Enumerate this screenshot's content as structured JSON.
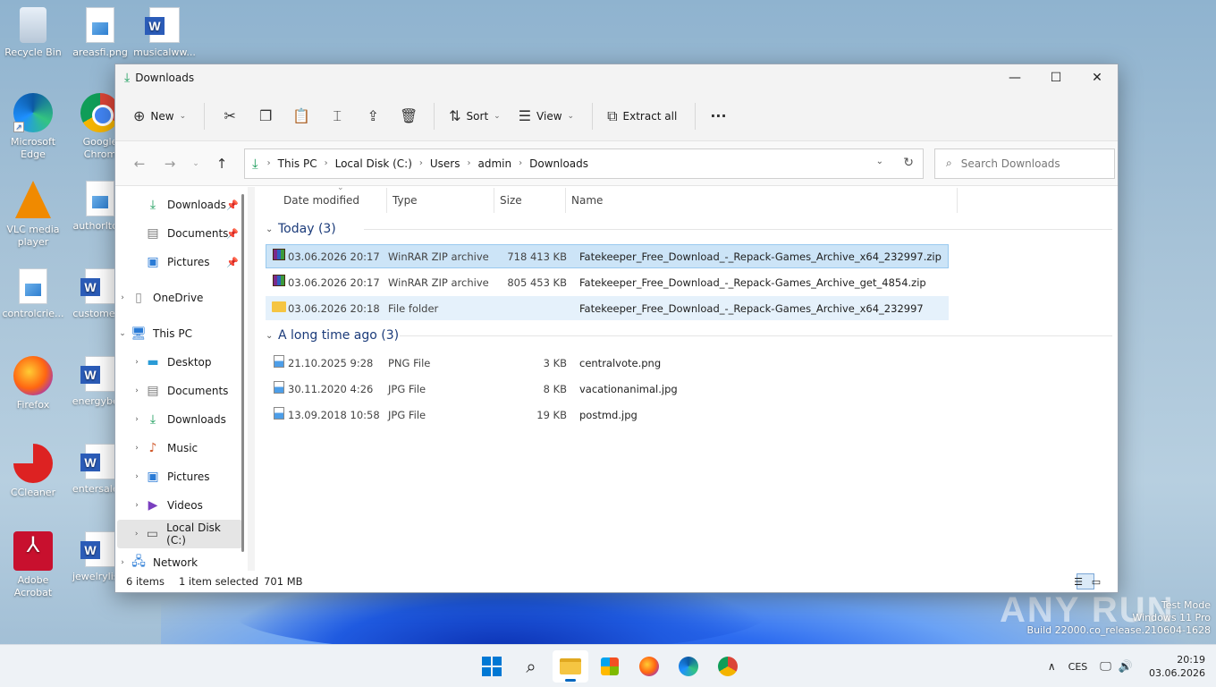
{
  "desktop": {
    "icons": [
      {
        "label": "Recycle Bin"
      },
      {
        "label": "areasfi.png"
      },
      {
        "label": "musicalww..."
      },
      {
        "label": "Microsoft\nEdge"
      },
      {
        "label": "Google\nChrom"
      },
      {
        "label": "VLC media\nplayer"
      },
      {
        "label": "authorltd..."
      },
      {
        "label": "controlcrie..."
      },
      {
        "label": "customer..."
      },
      {
        "label": "Firefox"
      },
      {
        "label": "energybe..."
      },
      {
        "label": "CCleaner"
      },
      {
        "label": "entersale..."
      },
      {
        "label": "Adobe\nAcrobat"
      },
      {
        "label": "jewelrylis..."
      }
    ]
  },
  "window": {
    "title": "Downloads",
    "controls": {
      "minimize": "—",
      "maximize": "☐",
      "close": "✕"
    }
  },
  "toolbar": {
    "new_label": "New",
    "sort_label": "Sort",
    "view_label": "View",
    "extract_label": "Extract all",
    "more_label": "···"
  },
  "address": {
    "crumbs": [
      "This PC",
      "Local Disk (C:)",
      "Users",
      "admin",
      "Downloads"
    ]
  },
  "search": {
    "placeholder": "Search Downloads"
  },
  "nav_pane": {
    "quick": [
      {
        "label": "Downloads",
        "icon": "download-icon"
      },
      {
        "label": "Documents",
        "icon": "document-icon"
      },
      {
        "label": "Pictures",
        "icon": "pictures-icon"
      }
    ],
    "onedrive": "OneDrive",
    "thispc": "This PC",
    "thispc_children": [
      {
        "label": "Desktop"
      },
      {
        "label": "Documents"
      },
      {
        "label": "Downloads"
      },
      {
        "label": "Music"
      },
      {
        "label": "Pictures"
      },
      {
        "label": "Videos"
      },
      {
        "label": "Local Disk (C:)"
      }
    ],
    "network": "Network"
  },
  "columns": {
    "date": "Date modified",
    "type": "Type",
    "size": "Size",
    "name": "Name"
  },
  "groups": [
    {
      "title": "Today (3)",
      "rows": [
        {
          "date": "03.06.2026 20:17",
          "type": "WinRAR ZIP archive",
          "size": "718 413 KB",
          "name": "Fatekeeper_Free_Download_-_Repack-Games_Archive_x64_232997.zip",
          "icon": "rar",
          "state": "selected"
        },
        {
          "date": "03.06.2026 20:17",
          "type": "WinRAR ZIP archive",
          "size": "805 453 KB",
          "name": "Fatekeeper_Free_Download_-_Repack-Games_Archive_get_4854.zip",
          "icon": "rar",
          "state": ""
        },
        {
          "date": "03.06.2026 20:18",
          "type": "File folder",
          "size": "",
          "name": "Fatekeeper_Free_Download_-_Repack-Games_Archive_x64_232997",
          "icon": "folder",
          "state": "hover"
        }
      ]
    },
    {
      "title": "A long time ago (3)",
      "rows": [
        {
          "date": "21.10.2025 9:28",
          "type": "PNG File",
          "size": "3 KB",
          "name": "centralvote.png",
          "icon": "image",
          "state": ""
        },
        {
          "date": "30.11.2020 4:26",
          "type": "JPG File",
          "size": "8 KB",
          "name": "vacationanimal.jpg",
          "icon": "image",
          "state": ""
        },
        {
          "date": "13.09.2018 10:58",
          "type": "JPG File",
          "size": "19 KB",
          "name": "postmd.jpg",
          "icon": "image",
          "state": ""
        }
      ]
    }
  ],
  "status": {
    "items": "6 items",
    "selected": "1 item selected",
    "size": "701 MB"
  },
  "watermark": {
    "brand": "ANY RUN",
    "line1": "Test Mode",
    "line2": "Windows 11 Pro",
    "line3": "Build 22000.co_release.210604-1628"
  },
  "taskbar": {
    "lang": "CES",
    "time": "20:19",
    "date": "03.06.2026"
  }
}
